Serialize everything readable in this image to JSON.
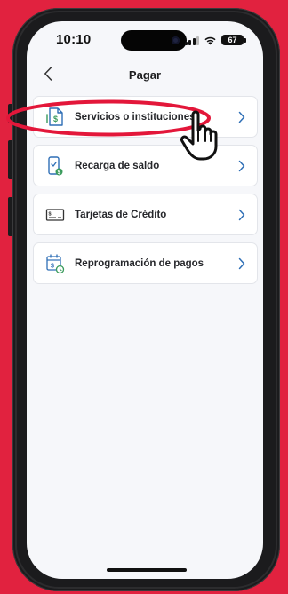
{
  "status_bar": {
    "time": "10:10",
    "battery_level": "67",
    "signal_icon": "cellular-signal-icon",
    "wifi_icon": "wifi-icon"
  },
  "header": {
    "title": "Pagar",
    "back_icon": "chevron-left-icon"
  },
  "menu": {
    "items": [
      {
        "label": "Servicios o instituciones",
        "icon": "service-document-dollar-icon"
      },
      {
        "label": "Recarga de saldo",
        "icon": "phone-recharge-icon"
      },
      {
        "label": "Tarjetas de Crédito",
        "icon": "credit-card-icon"
      },
      {
        "label": "Reprogramación de pagos",
        "icon": "calendar-clock-icon"
      }
    ],
    "chevron_icon": "chevron-right-icon"
  },
  "colors": {
    "background": "#e1223f",
    "annotation": "#e3173a",
    "accent_blue": "#2f6fb6",
    "accent_green": "#3a9b5c",
    "screen": "#f6f7fa"
  }
}
